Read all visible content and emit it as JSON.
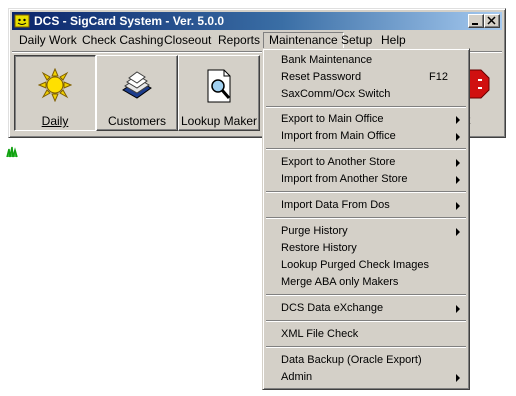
{
  "window": {
    "title": "DCS - SigCard System - Ver. 5.0.0"
  },
  "menubar": [
    {
      "label": "Daily Work"
    },
    {
      "label": "Check Cashing"
    },
    {
      "label": "Closeout"
    },
    {
      "label": "Reports"
    },
    {
      "label": "Maintenance",
      "active": true
    },
    {
      "label": "Setup"
    },
    {
      "label": "Help"
    }
  ],
  "toolbar": [
    {
      "label": "Daily",
      "icon": "sun-icon"
    },
    {
      "label": "Customers",
      "icon": "card-file-icon"
    },
    {
      "label": "Lookup Maker",
      "icon": "document-magnifier-icon"
    }
  ],
  "maintenance_menu": {
    "items": [
      {
        "label": "Bank Maintenance"
      },
      {
        "label": "Reset Password",
        "shortcut": "F12"
      },
      {
        "label": "SaxComm/Ocx Switch"
      },
      {
        "label": "Export to Main Office",
        "submenu": true
      },
      {
        "label": "Import from Main Office",
        "submenu": true
      },
      {
        "label": "Export to Another Store",
        "submenu": true
      },
      {
        "label": "Import from Another Store",
        "submenu": true
      },
      {
        "label": "Import Data From Dos",
        "submenu": true
      },
      {
        "label": "Purge History",
        "submenu": true
      },
      {
        "label": "Restore History"
      },
      {
        "label": "Lookup Purged Check Images"
      },
      {
        "label": "Merge ABA only Makers"
      },
      {
        "label": "DCS Data eXchange",
        "submenu": true
      },
      {
        "label": "XML File Check"
      },
      {
        "label": "Data Backup (Oracle Export)"
      },
      {
        "label": "Admin",
        "submenu": true
      }
    ]
  },
  "colors": {
    "face": "#d4d0c8",
    "title_start": "#0a246a",
    "title_end": "#a6caf0"
  }
}
